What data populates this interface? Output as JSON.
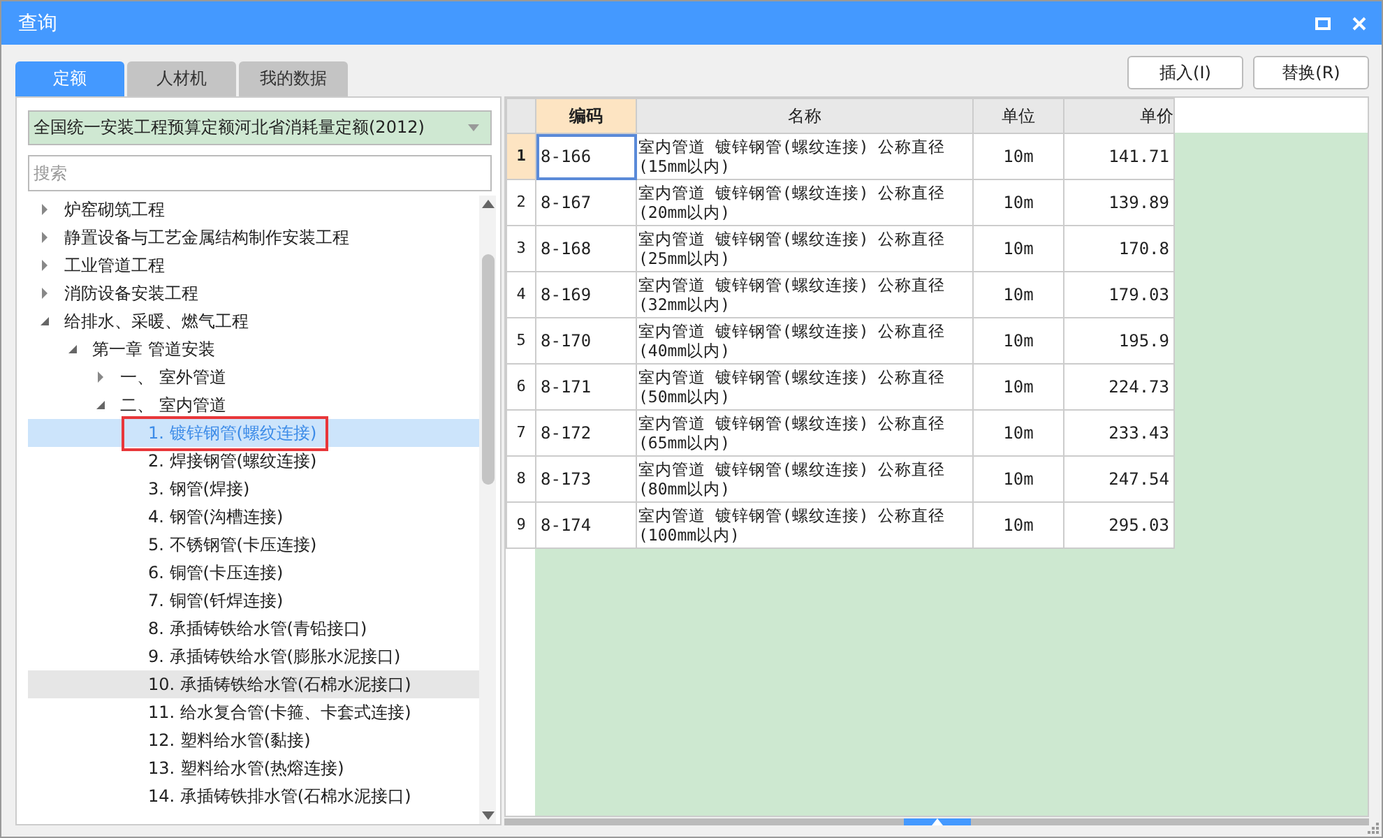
{
  "window": {
    "title": "查询"
  },
  "tabs": [
    {
      "label": "定额",
      "selected": true
    },
    {
      "label": "人材机",
      "selected": false
    },
    {
      "label": "我的数据",
      "selected": false
    }
  ],
  "buttons": [
    "插入(I)",
    "替换(R)"
  ],
  "library_select": {
    "value": "全国统一安装工程预算定额河北省消耗量定额(2012)"
  },
  "search": {
    "placeholder": "搜索"
  },
  "tree": [
    {
      "label": "炉窑砌筑工程",
      "expanded": false,
      "selected": false,
      "hovered": false
    },
    {
      "label": "静置设备与工艺金属结构制作安装工程",
      "expanded": false,
      "selected": false,
      "hovered": false
    },
    {
      "label": "工业管道工程",
      "expanded": false,
      "selected": false,
      "hovered": false
    },
    {
      "label": "消防设备安装工程",
      "expanded": false,
      "selected": false,
      "hovered": false
    },
    {
      "label": "给排水、采暖、燃气工程",
      "expanded": true,
      "selected": false,
      "hovered": false,
      "children": [
        {
          "label": "第一章 管道安装",
          "expanded": true,
          "selected": false,
          "hovered": false,
          "children": [
            {
              "label": "一、 室外管道",
              "expanded": false,
              "selected": false,
              "hovered": false
            },
            {
              "label": "二、 室内管道",
              "expanded": true,
              "selected": false,
              "hovered": false,
              "children": [
                {
                  "label": "1. 镀锌钢管(螺纹连接)",
                  "selected": true,
                  "hovered": false
                },
                {
                  "label": "2. 焊接钢管(螺纹连接)",
                  "selected": false,
                  "hovered": false
                },
                {
                  "label": "3. 钢管(焊接)",
                  "selected": false,
                  "hovered": false
                },
                {
                  "label": "4. 钢管(沟槽连接)",
                  "selected": false,
                  "hovered": false
                },
                {
                  "label": "5. 不锈钢管(卡压连接)",
                  "selected": false,
                  "hovered": false
                },
                {
                  "label": "6. 铜管(卡压连接)",
                  "selected": false,
                  "hovered": false
                },
                {
                  "label": "7. 铜管(钎焊连接)",
                  "selected": false,
                  "hovered": false
                },
                {
                  "label": "8. 承插铸铁给水管(青铅接口)",
                  "selected": false,
                  "hovered": false
                },
                {
                  "label": "9. 承插铸铁给水管(膨胀水泥接口)",
                  "selected": false,
                  "hovered": false
                },
                {
                  "label": "10. 承插铸铁给水管(石棉水泥接口)",
                  "selected": false,
                  "hovered": true
                },
                {
                  "label": "11. 给水复合管(卡箍、卡套式连接)",
                  "selected": false,
                  "hovered": false
                },
                {
                  "label": "12. 塑料给水管(黏接)",
                  "selected": false,
                  "hovered": false
                },
                {
                  "label": "13. 塑料给水管(热熔连接)",
                  "selected": false,
                  "hovered": false
                },
                {
                  "label": "14. 承插铸铁排水管(石棉水泥接口)",
                  "selected": false,
                  "hovered": false
                }
              ]
            }
          ]
        }
      ]
    }
  ],
  "table": {
    "columns": [
      {
        "label": "编码",
        "selected": true
      },
      {
        "label": "名称",
        "selected": false
      },
      {
        "label": "单位",
        "selected": false
      },
      {
        "label": "单价",
        "selected": false
      }
    ],
    "rows": [
      {
        "number": "1",
        "selected": true,
        "cells": [
          "8-166",
          "室内管道 镀锌钢管(螺纹连接) 公称直径(15mm以内)",
          "10m",
          "141.71"
        ]
      },
      {
        "number": "2",
        "selected": false,
        "cells": [
          "8-167",
          "室内管道 镀锌钢管(螺纹连接) 公称直径(20mm以内)",
          "10m",
          "139.89"
        ]
      },
      {
        "number": "3",
        "selected": false,
        "cells": [
          "8-168",
          "室内管道 镀锌钢管(螺纹连接) 公称直径(25mm以内)",
          "10m",
          "170.8"
        ]
      },
      {
        "number": "4",
        "selected": false,
        "cells": [
          "8-169",
          "室内管道 镀锌钢管(螺纹连接) 公称直径(32mm以内)",
          "10m",
          "179.03"
        ]
      },
      {
        "number": "5",
        "selected": false,
        "cells": [
          "8-170",
          "室内管道 镀锌钢管(螺纹连接) 公称直径(40mm以内)",
          "10m",
          "195.9"
        ]
      },
      {
        "number": "6",
        "selected": false,
        "cells": [
          "8-171",
          "室内管道 镀锌钢管(螺纹连接) 公称直径(50mm以内)",
          "10m",
          "224.73"
        ]
      },
      {
        "number": "7",
        "selected": false,
        "cells": [
          "8-172",
          "室内管道 镀锌钢管(螺纹连接) 公称直径(65mm以内)",
          "10m",
          "233.43"
        ]
      },
      {
        "number": "8",
        "selected": false,
        "cells": [
          "8-173",
          "室内管道 镀锌钢管(螺纹连接) 公称直径(80mm以内)",
          "10m",
          "247.54"
        ]
      },
      {
        "number": "9",
        "selected": false,
        "cells": [
          "8-174",
          "室内管道 镀锌钢管(螺纹连接) 公称直径(100mm以内)",
          "10m",
          "295.03"
        ]
      }
    ]
  }
}
